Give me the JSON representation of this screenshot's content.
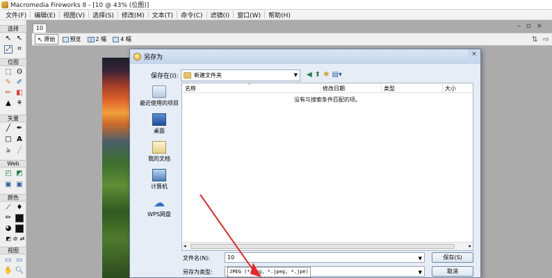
{
  "window": {
    "title": "Macromedia Fireworks 8 - [10 @ 43% (位图)]"
  },
  "menu": [
    "文件(F)",
    "编辑(E)",
    "视图(V)",
    "选择(S)",
    "修改(M)",
    "文本(T)",
    "命令(C)",
    "滤镜(I)",
    "窗口(W)",
    "帮助(H)"
  ],
  "tools": {
    "sections": [
      "选择",
      "位图",
      "矢量",
      "Web",
      "颜色",
      "视图"
    ]
  },
  "document": {
    "tab": "10",
    "view_buttons": [
      "原始",
      "预览",
      "2 幅",
      "4 幅"
    ]
  },
  "dialog": {
    "title": "另存为",
    "close_label": "×",
    "save_in_label": "保存在(I):",
    "save_in_value": "新建文件夹",
    "places": [
      "最近使用的项目",
      "桌面",
      "我的文档",
      "计算机",
      "WPS网盘"
    ],
    "columns": [
      "名称",
      "修改日期",
      "类型",
      "大小"
    ],
    "empty_message": "没有与搜索条件匹配的项。",
    "filename_label": "文件名(N):",
    "filename_value": "10",
    "filetype_label": "另存为类型:",
    "filetype_value": "JPEG (*.jpg, *.jpeg, *.jpe)",
    "save_button": "保存(S)",
    "cancel_button": "取消"
  },
  "colors": {
    "arrow": "#e8262b",
    "dialog_bg": "#e6edf7",
    "title_gradient_top": "#dae6f5"
  }
}
